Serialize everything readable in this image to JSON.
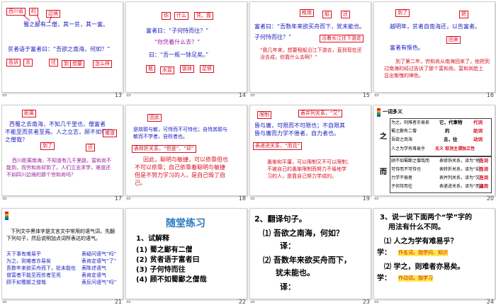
{
  "slides": {
    "s13": {
      "number": "13",
      "line1": "蜀之鄙有二僧，其一贫，其一富。",
      "line2": "贫者语于富者曰：“吾欲之南海，何如？”",
      "boxes": [
        "西川省",
        "的",
        "边境",
        "告诉",
        "去",
        "到",
        "往",
        "想要",
        "怎么样"
      ]
    },
    "s14": {
      "number": "14",
      "boxes": [
        "你",
        "什么",
        "凭、靠",
        "瓶",
        "水盆",
        "饭钵"
      ],
      "line1": "富者曰：“子何恃而往？”",
      "line2": "“你凭着什么去？”",
      "line3": "曰：“吾一瓶一钵足矣。”"
    },
    "s15": {
      "number": "15",
      "boxes": [
        "租用",
        "船",
        "还",
        "沿着长江往下游走"
      ],
      "line1": "富者曰：“吾数年来欲买舟而下，犹未能也。",
      "line2": "子何恃而往？”",
      "line3": "“我几年来，想要租船沿江下游去，直到现在还",
      "line4": "没去成，你靠什么去啊？”"
    },
    "s16": {
      "number": "16",
      "boxes": [
        "到了",
        "把",
        "回来"
      ],
      "line1": "越明年，贫者自南海还，以告富者。",
      "line2": "富者有惭色。",
      "line3": "到了第二年，穷和尚从南海回来了，他把到",
      "line4": "过南海的经过告诉了那个富和尚。富和尚脸上",
      "line5": "显出惭愧的神色。"
    },
    "s17": {
      "number": "17",
      "boxes": [
        "距离",
        "到了",
        "难道",
        "还"
      ],
      "line1": "西蜀之去南海，不知几千里也，僧富者",
      "line2": "不能至而贫者至焉。人之立志，顾不如蜀鄙",
      "line3": "之僧哉？",
      "line4": "西川距离南海，不知道有几千里路，富和尚不",
      "line5": "能到，而穷和尚却到了。人们立志求学，难道还",
      "line6": "不如四川边境的那个穷和尚吗？"
    },
    "s18": {
      "number": "18",
      "boxes": [
        "因此",
        "表转折关系，“但是”、“却”"
      ],
      "line1": "是故聪与敏，可恃而不可恃也；自恃其聪与",
      "line2": "敏而不学者，自败者也。",
      "line3": "因此，聪明与敏捷，可以依靠但也",
      "line4": "不可以依靠；自己依靠着聪明与敏捷",
      "line5": "但是不努力学习的人，是自己毁了自",
      "line6": "己。"
    },
    "s19": {
      "number": "19",
      "boxes": [
        "限制",
        "表并列关系，“又”",
        "表递进关系，“而且”"
      ],
      "line1": "昏与庸，可限而不可限也；不自限其",
      "line2": "昏与庸而力学不倦者，自力者也。",
      "line3": "愚笨和平庸，可以限制又不可以限制；",
      "line4": "不被自己的愚笨限制而努力不倦地学",
      "line5": "习的人，是靠自己努力学成的。"
    },
    "s20": {
      "number": "20",
      "title": "一词多义",
      "char_zhi": "之",
      "char_er": "而",
      "rows_zhi": [
        [
          "为之，则难者亦易矣",
          "它，代事物",
          "代词"
        ],
        [
          "蜀之鄙有二僧",
          "的",
          "助词"
        ],
        [
          "吾欲之南海",
          "去，往",
          "动词"
        ],
        [
          "人之为学有难易乎",
          "无义 取消主谓独立性",
          "助词"
        ]
      ],
      "rows_er": [
        [
          "顾不如蜀鄙之僧哉而",
          "表修饰关系，译为“地”",
          "连词"
        ],
        [
          "可恃而不可恃也",
          "表转折关系，译为“却”",
          "连词"
        ],
        [
          "力学不倦者",
          "表并列关系，译为“又”",
          "连词"
        ],
        [
          "子何恃而往",
          "表递进关系，译为“而且”",
          "连词"
        ]
      ]
    },
    "s21": {
      "number": "21",
      "intro1": "下列文中黑体字是文言文中常用的语气词，先翻",
      "intro2": "下列句子，然后说明加点词所表达的语气。",
      "rows": [
        [
          "天下事有难易乎",
          "表疑问语气“吗”"
        ],
        [
          "为之，则难者亦易矣",
          "表肯定语气“了”"
        ],
        [
          "吾数年来欲买舟而下，犹未能也",
          "表陈述语气"
        ],
        [
          "僧富者不能至而贫者至焉",
          "表肯定语气"
        ],
        [
          "顾不如蜀鄙之僧哉",
          "表反问语气“吗”"
        ]
      ]
    },
    "s22": {
      "number": "22",
      "title": "随堂练习",
      "heading": "1、试解释",
      "items": [
        "(1) 蜀之鄙有二僧",
        "(2) 贫者语于富者曰",
        "(3) 子何恃而往",
        "(4) 顾不如蜀鄙之僧哉"
      ]
    },
    "s23": {
      "number": "23",
      "heading": "2、翻译句子。",
      "q1": "⑴ 吾欲之南海，何如？",
      "a1": "译：",
      "q2": "⑵ 吾数年来欲买舟而下，",
      "q2b": "犹未能也。",
      "a2": "译："
    },
    "s24": {
      "number": "24",
      "heading1": "3、说一说下面两个“学”字的",
      "heading2": "用法有什么不同。",
      "q1": "⑴ 人之为学有难易乎？",
      "label1": "学：",
      "ans1": "作名词，指学问、知识",
      "q2": "⑵ 学之，则难者亦易矣。",
      "label2": "学：",
      "ans2": "作动词，指学习"
    }
  }
}
